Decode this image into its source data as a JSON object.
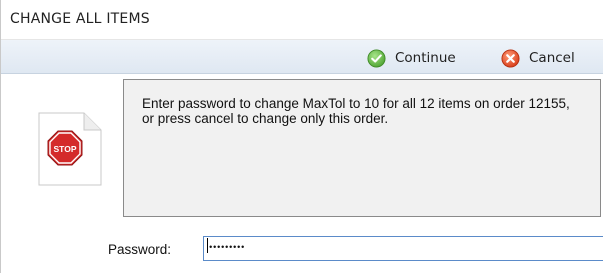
{
  "window": {
    "title": "CHANGE ALL ITEMS"
  },
  "toolbar": {
    "continue_label": "Continue",
    "continue_icon": "check-circle-icon",
    "continue_color": "#6cc04a",
    "cancel_label": "Cancel",
    "cancel_icon": "x-circle-icon",
    "cancel_color": "#e8502b"
  },
  "message": {
    "icon": "stop-sign-document-icon",
    "icon_text": "STOP",
    "text": "Enter password to change MaxTol to 10 for all 12 items on order 12155, or press cancel to change only this order."
  },
  "password": {
    "label": "Password:",
    "value": "•••••••••"
  }
}
